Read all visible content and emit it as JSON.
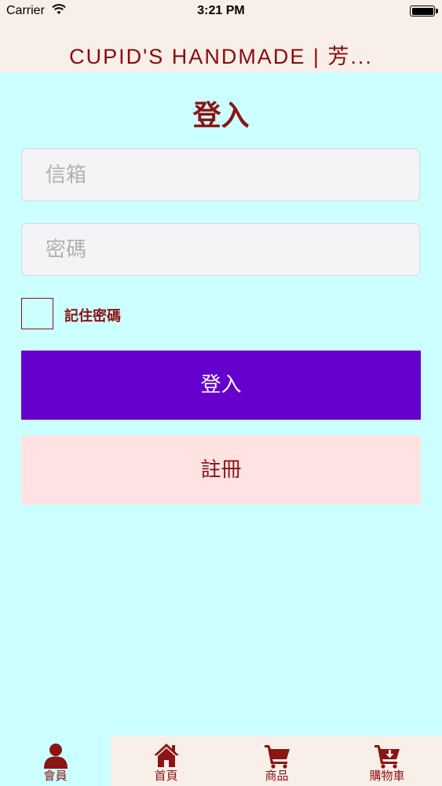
{
  "status_bar": {
    "carrier": "Carrier",
    "time": "3:21 PM"
  },
  "nav": {
    "title": "CUPID'S HANDMADE | 芳..."
  },
  "page": {
    "title": "登入"
  },
  "form": {
    "email_placeholder": "信箱",
    "password_placeholder": "密碼",
    "remember_label": "記住密碼",
    "remember_checked": false,
    "login_label": "登入",
    "register_label": "註冊"
  },
  "tabs": [
    {
      "label": "會員",
      "icon": "member-icon",
      "active": true
    },
    {
      "label": "首頁",
      "icon": "home-icon",
      "active": false
    },
    {
      "label": "商品",
      "icon": "cart-icon",
      "active": false
    },
    {
      "label": "購物車",
      "icon": "cart-download-icon",
      "active": false
    }
  ],
  "colors": {
    "background": "#ccffff",
    "header": "#f8efe9",
    "accent": "#8b1414",
    "login_button": "#6600cc",
    "register_button": "#ffe3e3"
  }
}
